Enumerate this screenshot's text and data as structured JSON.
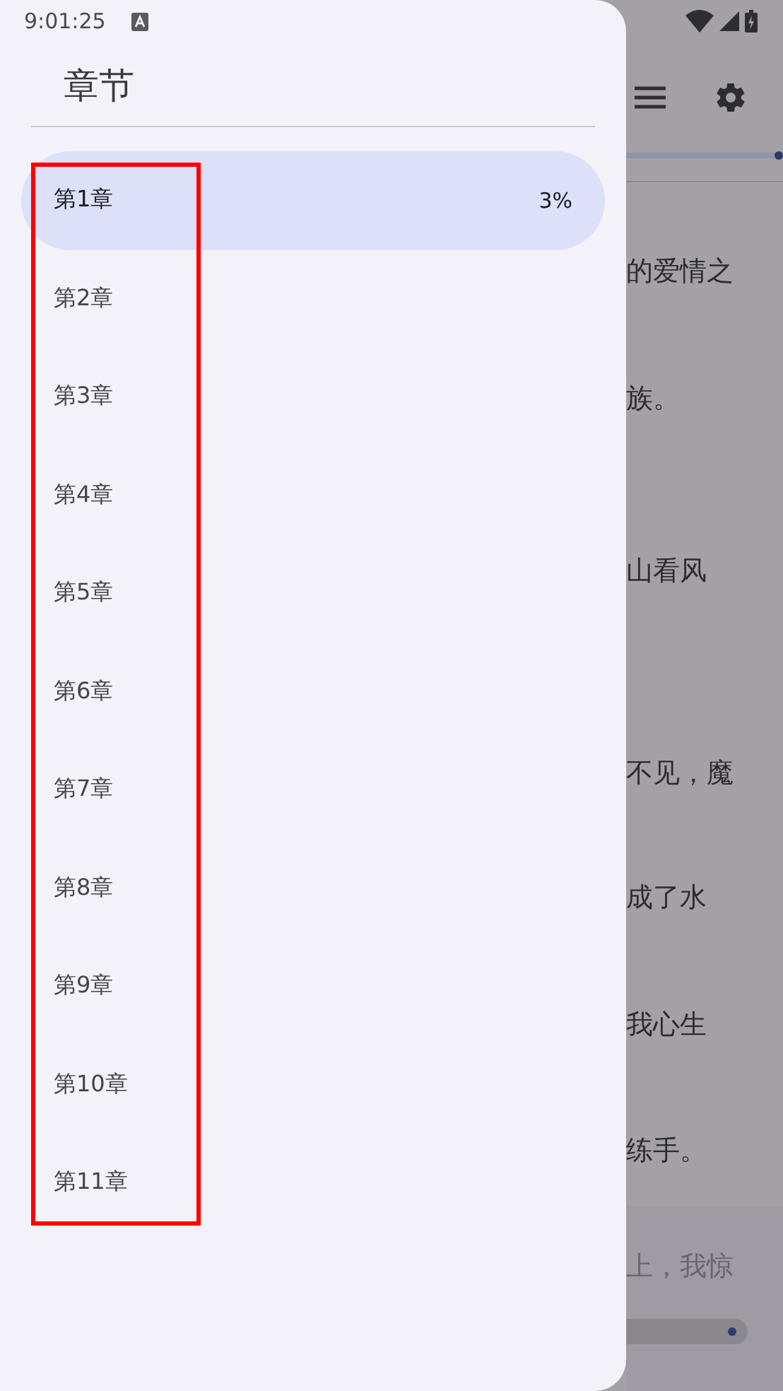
{
  "status_bar": {
    "time": "9:01:25"
  },
  "drawer": {
    "title": "章节",
    "chapters": [
      {
        "label": "第1章",
        "progress": "3%",
        "selected": true
      },
      {
        "label": "第2章",
        "selected": false
      },
      {
        "label": "第3章",
        "selected": false
      },
      {
        "label": "第4章",
        "selected": false
      },
      {
        "label": "第5章",
        "selected": false
      },
      {
        "label": "第6章",
        "selected": false
      },
      {
        "label": "第7章",
        "selected": false
      },
      {
        "label": "第8章",
        "selected": false
      },
      {
        "label": "第9章",
        "selected": false
      },
      {
        "label": "第10章",
        "selected": false
      },
      {
        "label": "第11章",
        "selected": false
      }
    ]
  },
  "reader": {
    "progress": {
      "level": 1
    },
    "slider": {
      "level": 1
    },
    "lines": [
      "的爱情之",
      "族。",
      "山看风",
      "不见，魔",
      "成了水",
      "我心生",
      "练手。"
    ],
    "footer_text": "上，我惊"
  }
}
